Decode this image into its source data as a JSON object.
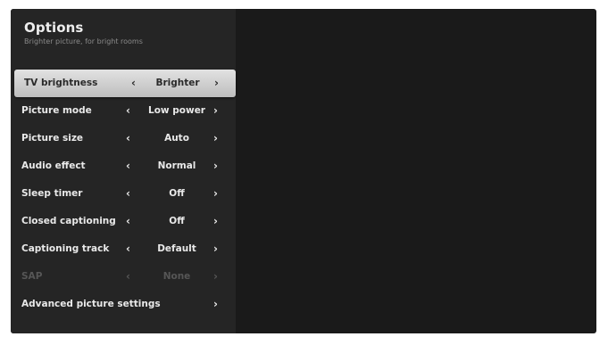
{
  "header": {
    "title": "Options",
    "subtitle": "Brighter picture, for bright rooms"
  },
  "arrows": {
    "left": "‹",
    "right": "›"
  },
  "menu": [
    {
      "label": "TV brightness",
      "value": "Brighter",
      "selected": true,
      "enabled": true
    },
    {
      "label": "Picture mode",
      "value": "Low power",
      "selected": false,
      "enabled": true
    },
    {
      "label": "Picture size",
      "value": "Auto",
      "selected": false,
      "enabled": true
    },
    {
      "label": "Audio effect",
      "value": "Normal",
      "selected": false,
      "enabled": true
    },
    {
      "label": "Sleep timer",
      "value": "Off",
      "selected": false,
      "enabled": true
    },
    {
      "label": "Closed captioning",
      "value": "Off",
      "selected": false,
      "enabled": true
    },
    {
      "label": "Captioning track",
      "value": "Default",
      "selected": false,
      "enabled": true
    },
    {
      "label": "SAP",
      "value": "None",
      "selected": false,
      "enabled": false
    },
    {
      "label": "Advanced picture settings",
      "value": "",
      "selected": false,
      "enabled": true
    }
  ],
  "colors": {
    "background": "#1a1a1a",
    "panel": "#252525",
    "highlight": "#d4d4d4",
    "text": "#e9e9e9",
    "disabled_text": "#565656"
  }
}
